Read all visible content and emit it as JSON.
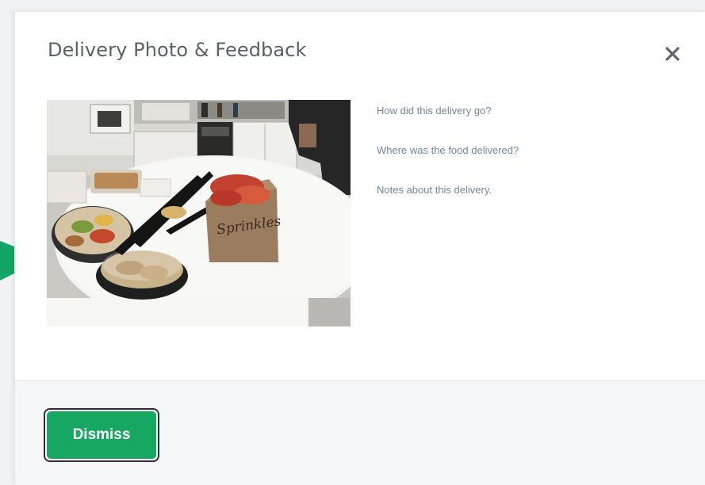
{
  "modal": {
    "title": "Delivery Photo & Feedback",
    "close_icon": "close-icon"
  },
  "photo": {
    "box_label": "Sprinkles"
  },
  "questions": [
    "How did this delivery go?",
    "Where was the food delivered?",
    "Notes about this delivery."
  ],
  "footer": {
    "dismiss_label": "Dismiss"
  },
  "colors": {
    "accent": "#16a862",
    "pointer_arrow": "#12a566",
    "question_text": "#6f86a3",
    "title_text": "#5b6067"
  }
}
